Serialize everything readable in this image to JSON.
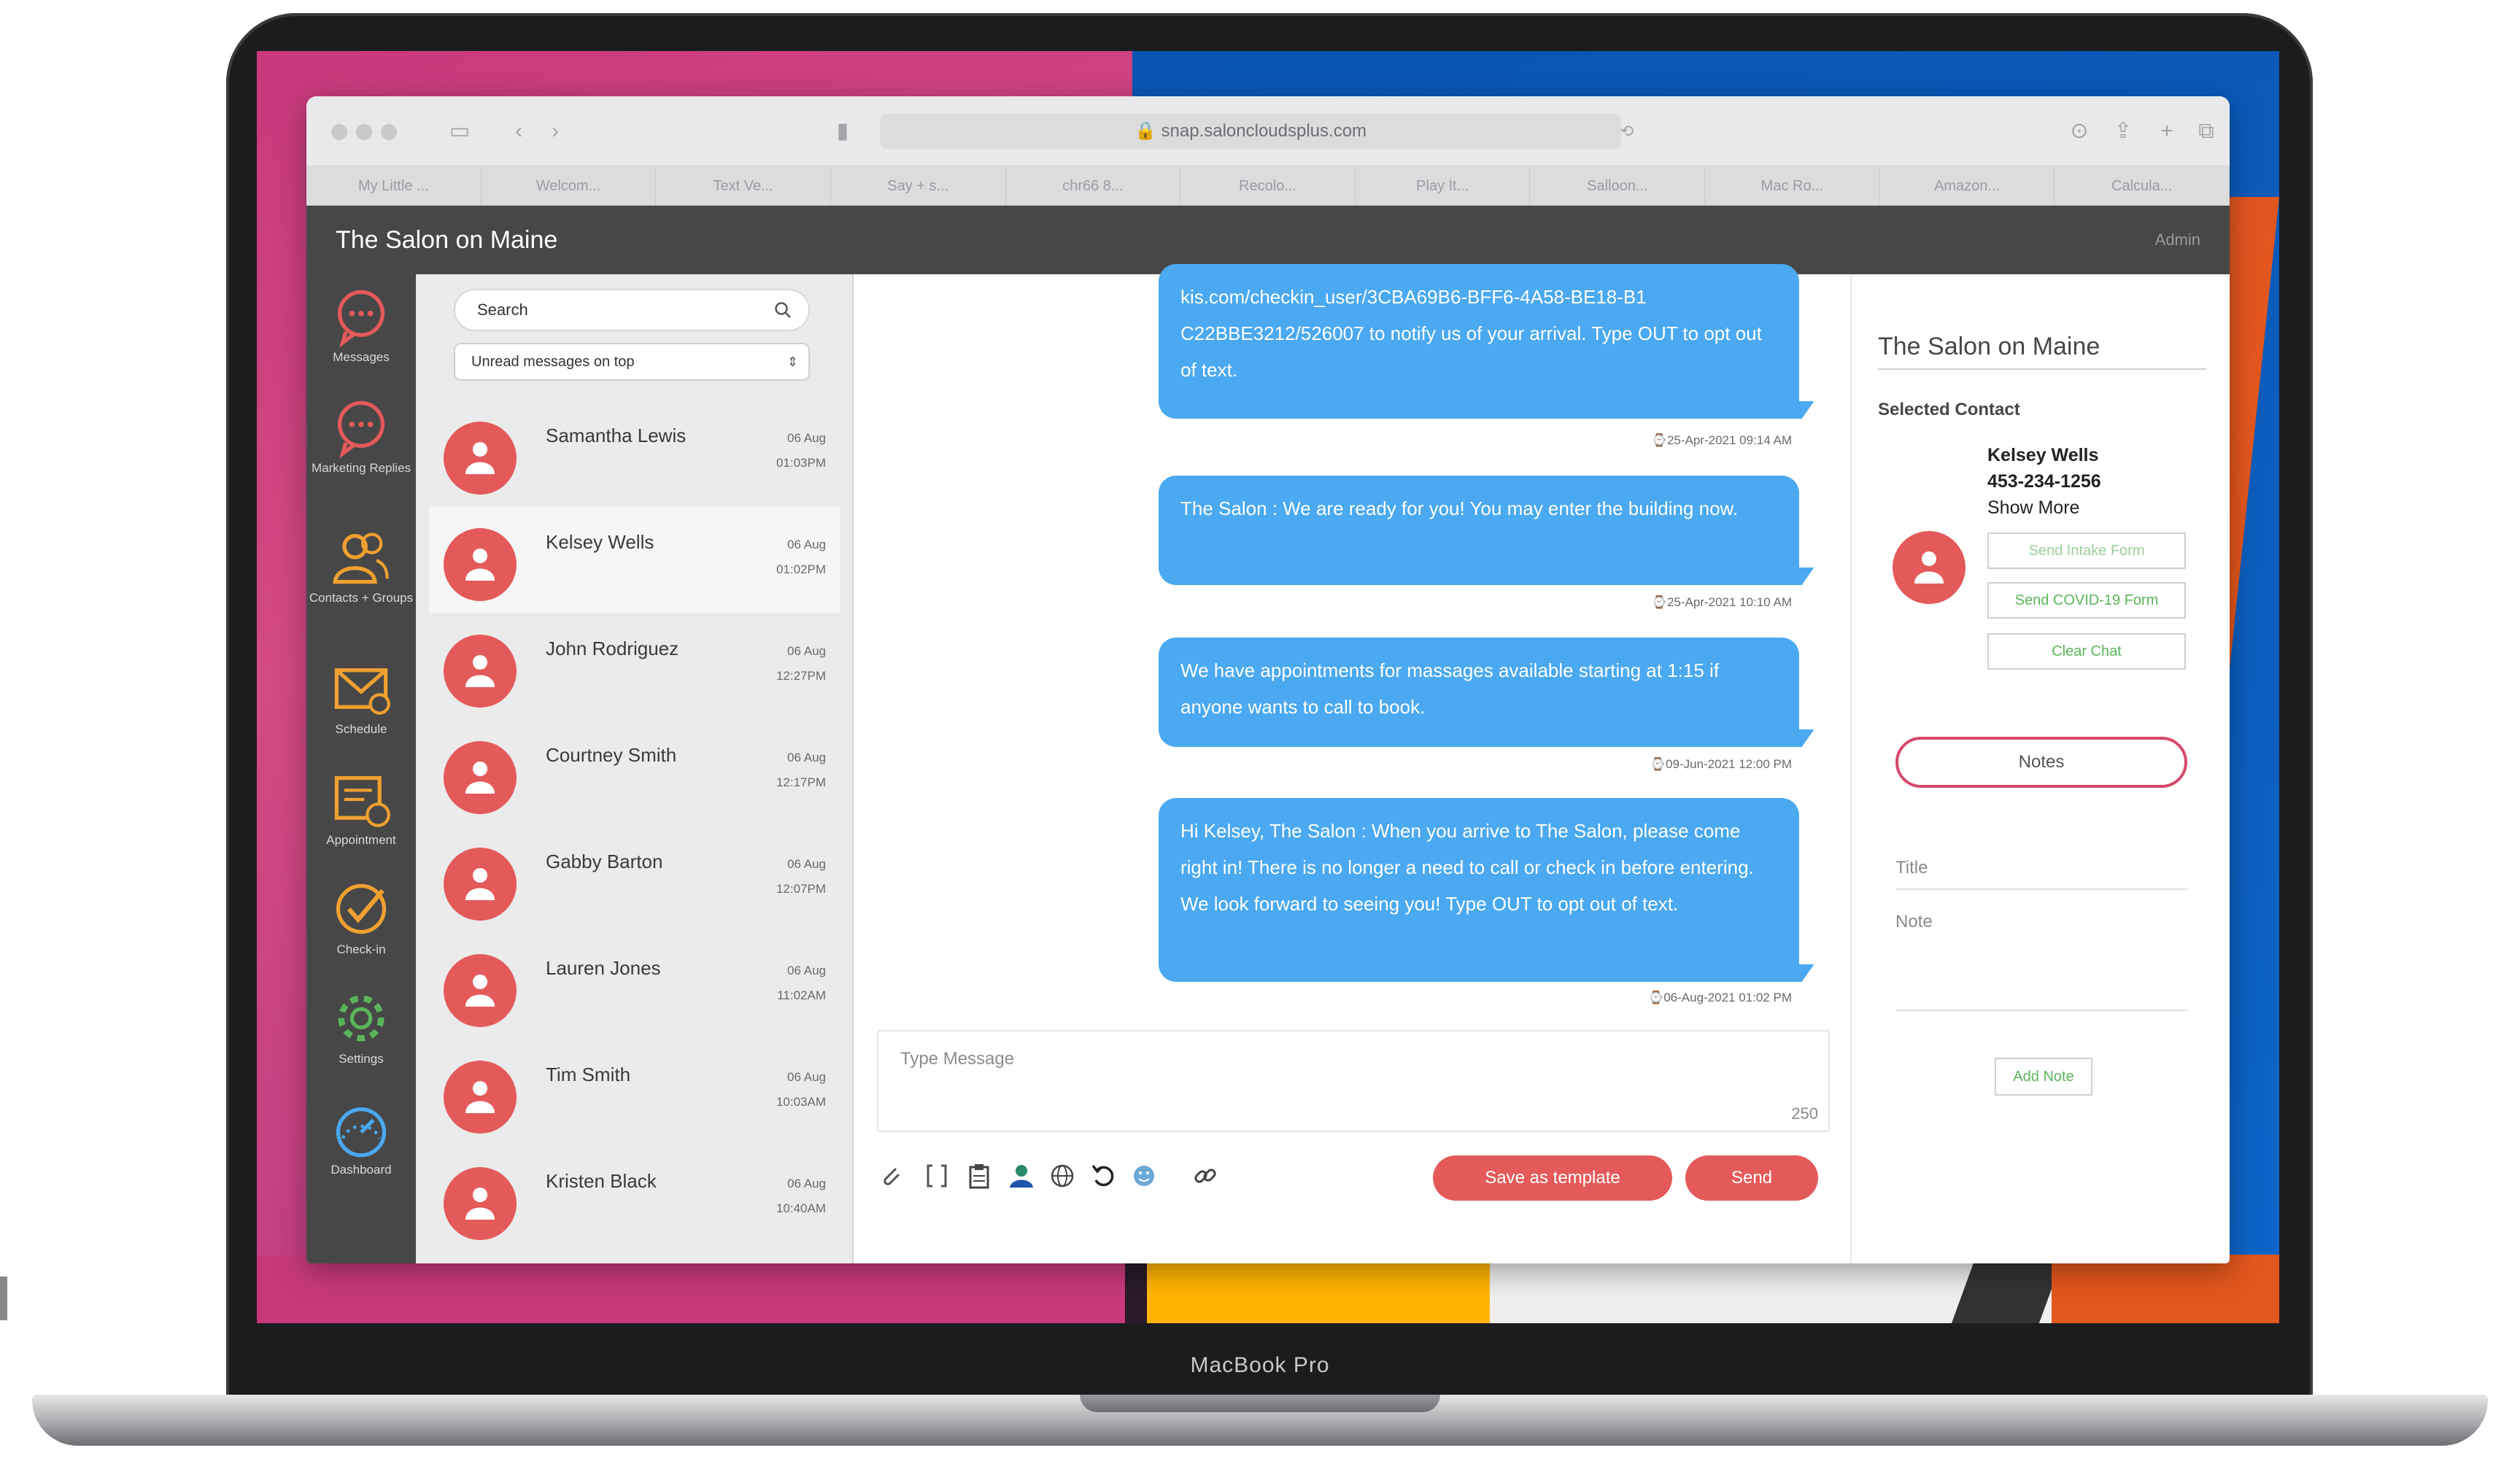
{
  "device": {
    "model_label": "MacBook Pro"
  },
  "browser": {
    "address": "snap.saloncloudsplus.com",
    "tabs": [
      "My Little ...",
      "Welcom...",
      "Text Ve...",
      "Say + s...",
      "chr66 8...",
      "Recolo...",
      "Play It...",
      "Salloon...",
      "Mac Ro...",
      "Amazon...",
      "Calcula..."
    ]
  },
  "app": {
    "title": "The Salon on Maine",
    "user": "Admin"
  },
  "sidebar": {
    "items": [
      {
        "label": "Messages",
        "icon": "messages-icon"
      },
      {
        "label": "Marketing Replies",
        "icon": "marketing-replies-icon"
      },
      {
        "label": "Contacts + Groups",
        "icon": "contacts-icon"
      },
      {
        "label": "Schedule",
        "icon": "schedule-icon"
      },
      {
        "label": "Appointment",
        "icon": "appointment-icon"
      },
      {
        "label": "Check-in",
        "icon": "check-in-icon"
      },
      {
        "label": "Settings",
        "icon": "settings-icon"
      },
      {
        "label": "Dashboard",
        "icon": "dashboard-icon"
      }
    ]
  },
  "conversations": {
    "search_placeholder": "Search",
    "sort_selected": "Unread messages on top",
    "items": [
      {
        "name": "Samantha Lewis",
        "date": "06 Aug",
        "time": "01:03PM"
      },
      {
        "name": "Kelsey Wells",
        "date": "06 Aug",
        "time": "01:02PM"
      },
      {
        "name": "John Rodriguez",
        "date": "06 Aug",
        "time": "12:27PM"
      },
      {
        "name": "Courtney Smith",
        "date": "06 Aug",
        "time": "12:17PM"
      },
      {
        "name": "Gabby Barton",
        "date": "06 Aug",
        "time": "12:07PM"
      },
      {
        "name": "Lauren Jones",
        "date": "06 Aug",
        "time": "11:02AM"
      },
      {
        "name": "Tim Smith",
        "date": "06 Aug",
        "time": "10:03AM"
      },
      {
        "name": "Kristen Black",
        "date": "06 Aug",
        "time": "10:40AM"
      }
    ]
  },
  "chat": {
    "messages": [
      {
        "text": "kis.com/checkin_user/3CBA69B6-BFF6-4A58-BE18-B1 C22BBE3212/526007 to notify us of your arrival. Type OUT to opt out of text.",
        "timestamp": "25-Apr-2021 09:14 AM"
      },
      {
        "text": "The Salon : We are ready for you! You may enter the building now.",
        "timestamp": "25-Apr-2021 10:10 AM"
      },
      {
        "text": "We have appointments for massages available starting at 1:15 if anyone wants to call to book.",
        "timestamp": "09-Jun-2021 12:00 PM"
      },
      {
        "text": "Hi Kelsey,  The Salon : When you arrive to  The Salon, please come right in! There is no longer a need to call or check in before entering. We look forward to seeing you! Type OUT to opt out of text.",
        "timestamp": "06-Aug-2021 01:02 PM"
      }
    ],
    "input_placeholder": "Type Message",
    "char_count": "250",
    "save_template_label": "Save as template",
    "send_label": "Send"
  },
  "right_panel": {
    "title": "The Salon on Maine",
    "selected_label": "Selected Contact",
    "contact_name": "Kelsey Wells",
    "contact_phone": "453-234-1256",
    "show_more": "Show More",
    "btn_intake": "Send Intake Form",
    "btn_covid": "Send COVID-19 Form",
    "btn_clear": "Clear Chat",
    "notes_label": "Notes",
    "title_field": "Title",
    "note_field": "Note",
    "add_note_label": "Add Note"
  },
  "colors": {
    "accent": "#e45a5a",
    "bubble": "#4aa9f0",
    "header": "#474747",
    "green": "#5ab55a",
    "notes_border": "#d64a6a"
  }
}
